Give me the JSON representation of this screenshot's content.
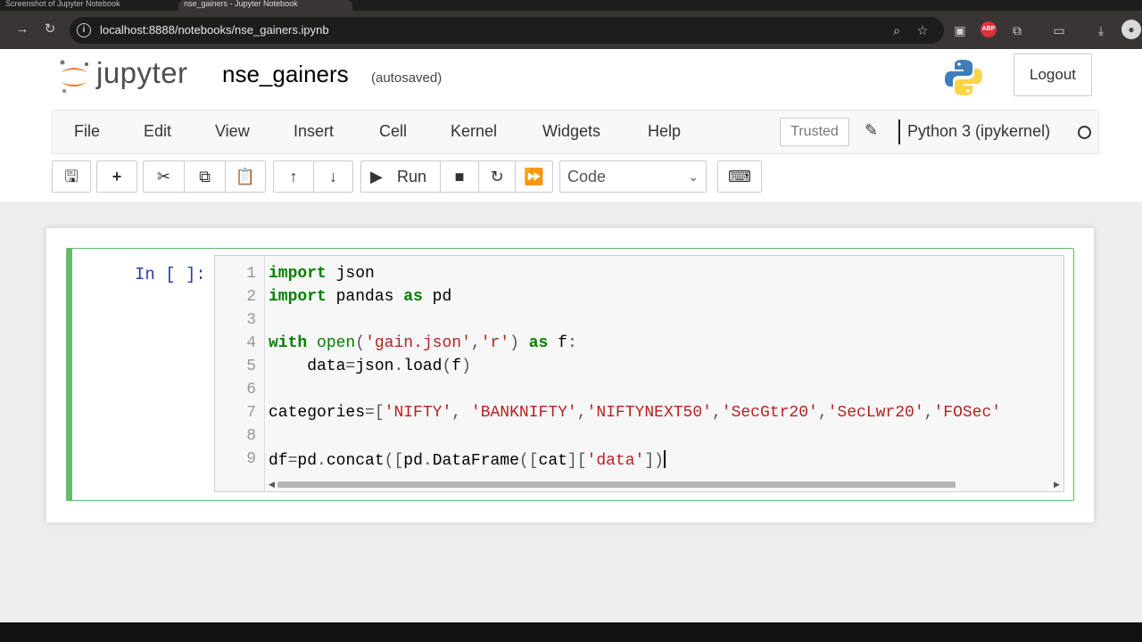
{
  "browser": {
    "tabs": [
      "Screenshot of Jupyter Notebook",
      "nse_gainers - Jupyter Notebook"
    ],
    "url": "localhost:8888/notebooks/nse_gainers.ipynb"
  },
  "header": {
    "logo_text": "jupyter",
    "notebook_name": "nse_gainers",
    "autosave_status": "(autosaved)",
    "logout_label": "Logout"
  },
  "menubar": {
    "items": [
      "File",
      "Edit",
      "View",
      "Insert",
      "Cell",
      "Kernel",
      "Widgets",
      "Help"
    ],
    "trusted_label": "Trusted",
    "kernel_name": "Python 3 (ipykernel)"
  },
  "toolbar": {
    "run_label": "Run",
    "cell_type": "Code"
  },
  "cell": {
    "prompt": "In [ ]:",
    "line_numbers": [
      "1",
      "2",
      "3",
      "4",
      "5",
      "6",
      "7",
      "8",
      "9"
    ],
    "lines": [
      "import json",
      "import pandas as pd",
      "",
      "with open('gain.json','r') as f:",
      "    data=json.load(f)",
      "",
      "categories=['NIFTY', 'BANKNIFTY','NIFTYNEXT50','SecGtr20','SecLwr20','FOSec'",
      "",
      "df=pd.concat([pd.DataFrame([cat]['data'])"
    ]
  },
  "colors": {
    "cell_border": "#66bb6a",
    "prompt": "#303f9f",
    "keyword": "#008000",
    "string": "#ba2121"
  }
}
